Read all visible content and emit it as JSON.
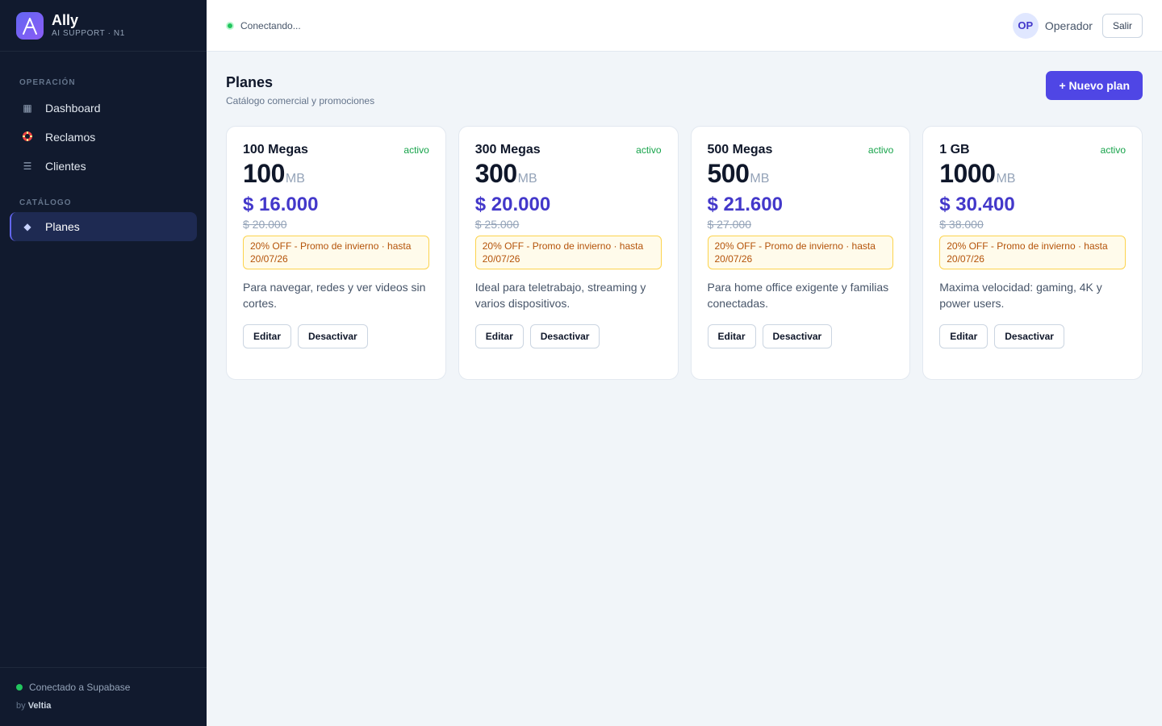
{
  "brand": {
    "name": "Ally",
    "subtitle": "AI SUPPORT · N1"
  },
  "sidebar": {
    "sections": [
      {
        "title": "OPERACIÓN",
        "items": [
          {
            "label": "Dashboard",
            "icon": "grid-icon"
          },
          {
            "label": "Reclamos",
            "icon": "lifebuoy-icon"
          },
          {
            "label": "Clientes",
            "icon": "list-icon"
          }
        ]
      },
      {
        "title": "CATÁLOGO",
        "items": [
          {
            "label": "Planes",
            "icon": "diamond-icon",
            "active": true
          }
        ]
      }
    ],
    "footer": {
      "connection": "Conectado a Supabase",
      "by": "by",
      "company": "Veltia"
    }
  },
  "header": {
    "status": "Conectando...",
    "avatar_initials": "OP",
    "user": "Operador",
    "logout_label": "Salir"
  },
  "page": {
    "title": "Planes",
    "subtitle": "Catálogo comercial y promociones",
    "new_button": "+ Nuevo plan"
  },
  "plans": [
    {
      "name": "100 Megas",
      "status": "activo",
      "speed": "100",
      "unit": "MB",
      "price": "$ 16.000",
      "old_price": "$ 20.000",
      "promo": "20% OFF - Promo de invierno · hasta 20/07/26",
      "description": "Para navegar, redes y ver videos sin cortes.",
      "edit_label": "Editar",
      "deactivate_label": "Desactivar"
    },
    {
      "name": "300 Megas",
      "status": "activo",
      "speed": "300",
      "unit": "MB",
      "price": "$ 20.000",
      "old_price": "$ 25.000",
      "promo": "20% OFF - Promo de invierno · hasta 20/07/26",
      "description": "Ideal para teletrabajo, streaming y varios dispositivos.",
      "edit_label": "Editar",
      "deactivate_label": "Desactivar"
    },
    {
      "name": "500 Megas",
      "status": "activo",
      "speed": "500",
      "unit": "MB",
      "price": "$ 21.600",
      "old_price": "$ 27.000",
      "promo": "20% OFF - Promo de invierno · hasta 20/07/26",
      "description": "Para home office exigente y familias conectadas.",
      "edit_label": "Editar",
      "deactivate_label": "Desactivar"
    },
    {
      "name": "1 GB",
      "status": "activo",
      "speed": "1000",
      "unit": "MB",
      "price": "$ 30.400",
      "old_price": "$ 38.000",
      "promo": "20% OFF - Promo de invierno · hasta 20/07/26",
      "description": "Maxima velocidad: gaming, 4K y power users.",
      "edit_label": "Editar",
      "deactivate_label": "Desactivar"
    }
  ],
  "colors": {
    "sidebar_bg": "#111a2e",
    "accent": "#4f46e5",
    "price": "#4338ca",
    "status_ok": "#22c55e",
    "promo_bg": "#fffbeb",
    "promo_border": "#fcd34d"
  }
}
